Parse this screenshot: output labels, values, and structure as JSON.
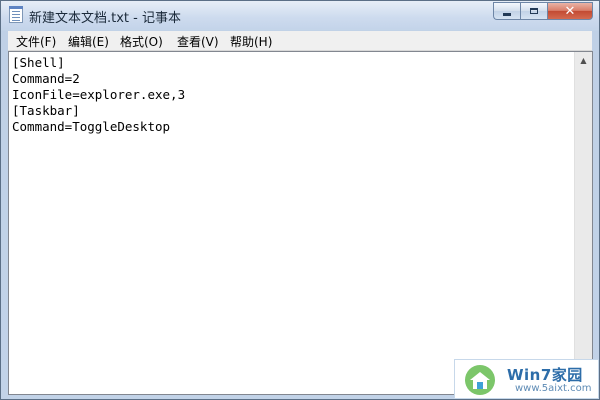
{
  "window": {
    "title": "新建文本文档.txt - 记事本"
  },
  "menu": [
    {
      "label": "文件(F)"
    },
    {
      "label": "编辑(E)"
    },
    {
      "label": "格式(O)"
    },
    {
      "label": "查看(V)"
    },
    {
      "label": "帮助(H)"
    }
  ],
  "editor": {
    "content": "[Shell]\nCommand=2\nIconFile=explorer.exe,3\n[Taskbar]\nCommand=ToggleDesktop"
  },
  "watermark": {
    "title": "Win7家园",
    "url": "www.5aixt.com"
  },
  "icons": {
    "app": "notepad-icon",
    "minimize": "minimize-icon",
    "maximize": "maximize-icon",
    "close": "close-icon",
    "scroll_up": "scroll-up-arrow-icon",
    "logo": "house-logo-icon"
  }
}
